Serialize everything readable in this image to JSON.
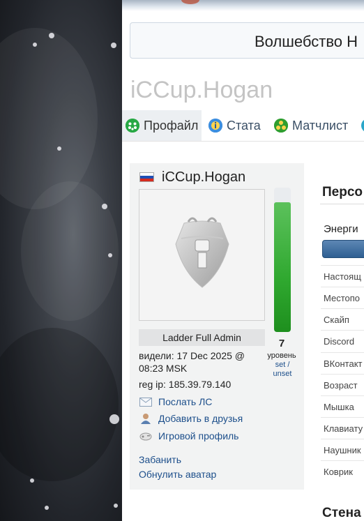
{
  "site_title": "Волшебство Н",
  "profile_heading": "iCCup.Hogan",
  "tabs": [
    {
      "label": "Профайл",
      "icon": "profile-icon",
      "color": "#27a844",
      "active": true
    },
    {
      "label": "Стата",
      "icon": "info-icon",
      "color": "#2f7fd1",
      "active": false
    },
    {
      "label": "Матчлист",
      "icon": "matchlist-icon",
      "color": "#2f9e2f",
      "active": false
    }
  ],
  "card": {
    "username": "iCCup.Hogan",
    "flag": "russia-flag",
    "badge": "Ladder Full Admin",
    "level": "7",
    "level_label": "уровень",
    "level_set": "set",
    "level_sep": "/",
    "level_unset": "unset",
    "level_fill_fraction": 0.9,
    "seen": "видели: 17 Dec 2025 @ 08:23 MSK",
    "reg_ip": "reg ip: 185.39.79.140",
    "actions": [
      {
        "label": "Послать ЛС",
        "icon": "envelope-icon"
      },
      {
        "label": "Добавить в друзья",
        "icon": "add-friend-icon"
      },
      {
        "label": "Игровой профиль",
        "icon": "game-profile-icon"
      }
    ],
    "admin_links": [
      "Забанить",
      "Обнулить аватар"
    ]
  },
  "personal": {
    "title": "Персо",
    "energy_label": "Энерги",
    "rows": [
      "Настоящ",
      "Местопо",
      "Скайп",
      "Discord",
      "ВКонтакт",
      "Возраст",
      "Мышка",
      "Клавиату",
      "Наушник",
      "Коврик"
    ]
  },
  "wall_title": "Стена",
  "colors": {
    "link": "#1d4f8b",
    "energy_fill": "#2fa82f",
    "energy_bar": "#2f5f92"
  }
}
